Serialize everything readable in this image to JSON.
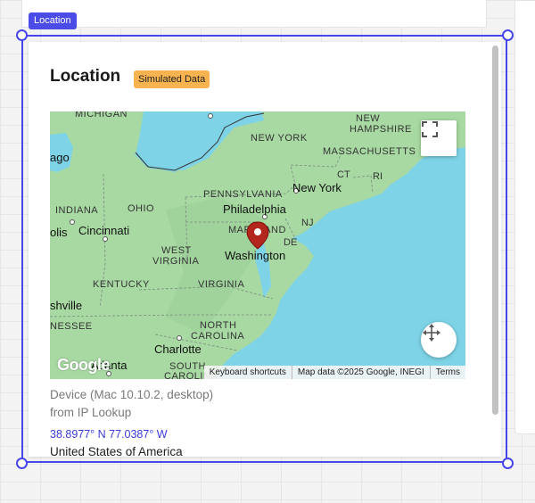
{
  "selection_tag": "Location",
  "card": {
    "title": "Location",
    "badge": "Simulated Data",
    "device": "Device (Mac 10.10.2, desktop)",
    "source": "from IP Lookup",
    "coords": "38.8977° N 77.0387° W",
    "country": "United States of America"
  },
  "map": {
    "labels": {
      "michigan": "MICHIGAN",
      "new_hampshire_1": "NEW",
      "new_hampshire_2": "HAMPSHIRE",
      "new_york_state": "NEW YORK",
      "massachusetts": "MASSACHUSETTS",
      "chicago": "ago",
      "ct": "CT",
      "ri": "RI",
      "pennsylvania": "PENNSYLVANIA",
      "new_york_city": "New York",
      "indiana": "INDIANA",
      "ohio": "OHIO",
      "philadelphia": "Philadelphia",
      "nj": "NJ",
      "indianapolis": "olis",
      "cincinnati": "Cincinnati",
      "maryland": "MARYLAND",
      "de": "DE",
      "west_virginia_1": "WEST",
      "west_virginia_2": "VIRGINIA",
      "washington": "Washington",
      "kentucky": "KENTUCKY",
      "virginia": "VIRGINIA",
      "nashville": "shville",
      "north_carolina_1": "NORTH",
      "north_carolina_2": "CAROLINA",
      "tennessee": "NESSEE",
      "charlotte": "Charlotte",
      "atlanta": "Atlanta",
      "south_carolina_1": "SOUTH",
      "south_carolina_2": "CAROLINA"
    },
    "logo": "Google",
    "attribution": {
      "shortcuts": "Keyboard shortcuts",
      "data": "Map data ©2025 Google, INEGI",
      "terms": "Terms"
    },
    "pin_color": "#b3261e"
  }
}
